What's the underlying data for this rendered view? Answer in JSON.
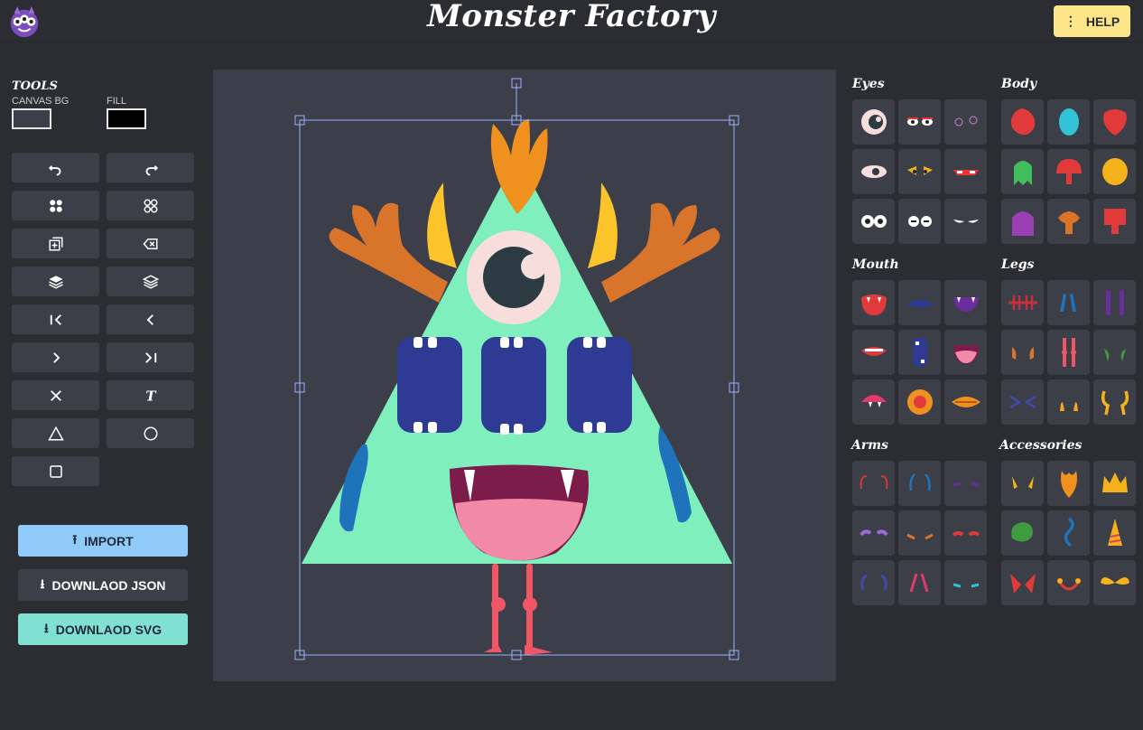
{
  "header": {
    "title": "Monster Factory",
    "help_label": "HELP"
  },
  "tools": {
    "title": "TOOLS",
    "canvas_bg_label": "CANVAS BG",
    "fill_label": "FILL",
    "canvas_bg_color": "#3c3f4a",
    "fill_color": "#000000",
    "buttons": [
      "undo-icon",
      "redo-icon",
      "group-icon",
      "ungroup-icon",
      "duplicate-icon",
      "delete-icon",
      "bring-forward-icon",
      "send-backward-icon",
      "bring-to-front-icon",
      "move-left-icon",
      "move-right-icon",
      "send-to-back-icon",
      "close-icon",
      "text-icon",
      "triangle-icon",
      "circle-icon",
      "square-icon"
    ]
  },
  "actions": {
    "import_label": "IMPORT",
    "download_json_label": "DOWNLAOD JSON",
    "download_svg_label": "DOWNLAOD SVG"
  },
  "palette": {
    "eyes": "Eyes",
    "body": "Body",
    "mouth": "Mouth",
    "legs": "Legs",
    "arms": "Arms",
    "accessories": "Accessories"
  },
  "colors": {
    "accent_yellow": "#fde68a",
    "import_blue": "#90caf9",
    "svg_teal": "#80e0d1",
    "monster_body": "#7eefbd",
    "monster_mouth_blue": "#2f3a94"
  }
}
